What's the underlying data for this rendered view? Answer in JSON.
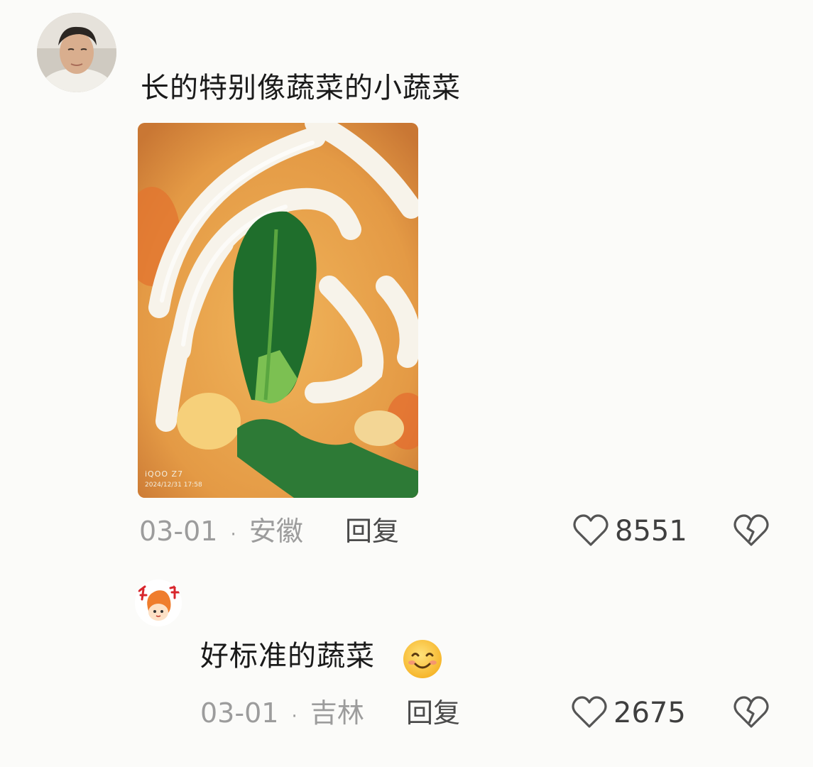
{
  "comment": {
    "text": "长的特别像蔬菜的小蔬菜",
    "photo": {
      "watermark_brand": "iQOO Z7",
      "watermark_date": "2024/12/31 17:58"
    },
    "date": "03-01",
    "separator": "·",
    "location": "安徽",
    "reply_label": "回复",
    "likes": "8551",
    "icons": {
      "like": "heart-outline-icon",
      "dislike": "broken-heart-icon"
    }
  },
  "reply": {
    "text": "好标准的蔬菜",
    "emoji": "smiling-face-emoji",
    "date": "03-01",
    "separator": "·",
    "location": "吉林",
    "reply_label": "回复",
    "likes": "2675",
    "icons": {
      "like": "heart-outline-icon",
      "dislike": "broken-heart-icon"
    }
  },
  "colors": {
    "background": "#fbfbf9",
    "meta_text": "#9c9c9c",
    "icon_stroke": "#555555"
  }
}
